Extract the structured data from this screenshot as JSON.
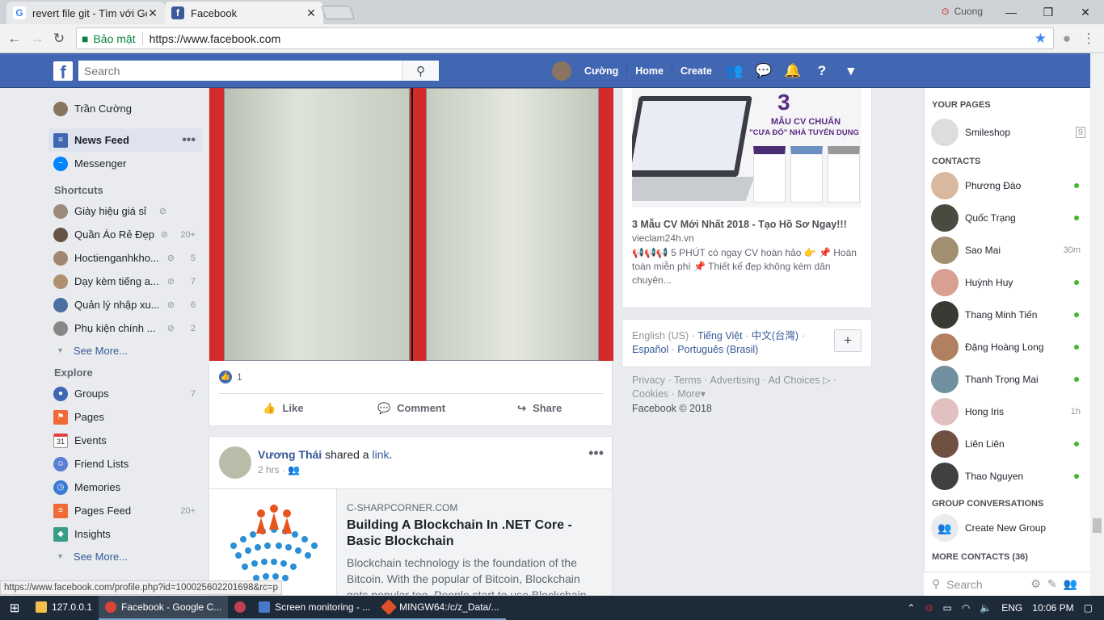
{
  "browser": {
    "tabs": [
      {
        "title": "revert file git - Tìm với Go",
        "favicon": "G"
      },
      {
        "title": "Facebook",
        "favicon": "f"
      }
    ],
    "user": "Cuong",
    "secure_label": "Bảo mật",
    "url": "https://www.facebook.com",
    "status_url": "https://www.facebook.com/profile.php?id=100025602201698&rc=p"
  },
  "fbbar": {
    "search_placeholder": "Search",
    "profile_name": "Cường",
    "home": "Home",
    "create": "Create"
  },
  "left": {
    "profile": "Trần Cường",
    "main": [
      {
        "label": "News Feed",
        "icon": "news-feed-icon"
      },
      {
        "label": "Messenger",
        "icon": "messenger-icon"
      }
    ],
    "shortcuts_title": "Shortcuts",
    "shortcuts": [
      {
        "label": "Giày hiệu giá sỉ",
        "badge": ""
      },
      {
        "label": "Quần Áo Rẻ Đẹp",
        "badge": "20+"
      },
      {
        "label": "Hoctienganhkho...",
        "badge": "5"
      },
      {
        "label": "Dạy kèm tiếng a...",
        "badge": "7"
      },
      {
        "label": "Quản lý nhập xu...",
        "badge": "6"
      },
      {
        "label": "Phụ kiện chính ...",
        "badge": "2"
      }
    ],
    "see_more": "See More...",
    "explore_title": "Explore",
    "explore": [
      {
        "label": "Groups",
        "badge": "7",
        "icon": "groups-icon"
      },
      {
        "label": "Pages",
        "badge": "",
        "icon": "pages-flag-icon"
      },
      {
        "label": "Events",
        "badge": "",
        "icon": "calendar-icon"
      },
      {
        "label": "Friend Lists",
        "badge": "",
        "icon": "friend-lists-icon"
      },
      {
        "label": "Memories",
        "badge": "",
        "icon": "clock-icon"
      },
      {
        "label": "Pages Feed",
        "badge": "20+",
        "icon": "pages-feed-icon"
      },
      {
        "label": "Insights",
        "badge": "",
        "icon": "cube-icon"
      }
    ],
    "see_more_2": "See More..."
  },
  "post1": {
    "like_count": "1",
    "like": "Like",
    "comment": "Comment",
    "share": "Share"
  },
  "post2": {
    "author": "Vương Thái",
    "verb": " shared a ",
    "object": "link",
    "time": "2 hrs · ",
    "link_domain": "C-SHARPCORNER.COM",
    "link_title": "Building A Blockchain In .NET Core - Basic Blockchain",
    "link_desc": "Blockchain technology is the foundation of the Bitcoin. With the popular of Bitcoin, Blockchain gets popular too. People start to use Blockchain..."
  },
  "ad": {
    "image_number": "3",
    "image_line1": "MẪU CV CHUẨN",
    "image_line2": "\"CƯA ĐỔ\" NHÀ TUYỂN DỤNG",
    "title": "3 Mẫu CV Mới Nhất 2018 - Tạo Hồ Sơ Ngay!!!",
    "domain": "vieclam24h.vn",
    "text": "📢📢📢 5 PHÚT có ngay CV hoàn hảo 👉 📌 Hoàn toàn miễn phí 📌 Thiết kế đẹp không kém dân chuyên..."
  },
  "lang": {
    "current": "English (US)",
    "options": [
      "Tiếng Việt",
      "中文(台灣)",
      "Español",
      "Português (Brasil)"
    ]
  },
  "footer": {
    "links": [
      "Privacy",
      "Terms",
      "Advertising",
      "Ad Choices",
      "Cookies",
      "More"
    ],
    "copyright": "Facebook © 2018"
  },
  "right": {
    "your_pages": "YOUR PAGES",
    "page": {
      "name": "Smileshop",
      "badge": "9"
    },
    "contacts_title": "CONTACTS",
    "contacts": [
      {
        "name": "Phương Đào",
        "status": "online",
        "color": "#d9b8a0"
      },
      {
        "name": "Quốc Trạng",
        "status": "online",
        "color": "#4a4a40"
      },
      {
        "name": "Sao Mai",
        "status": "30m",
        "color": "#a09070"
      },
      {
        "name": "Huỳnh Huy",
        "status": "online",
        "color": "#d8a090"
      },
      {
        "name": "Thang Minh Tiến",
        "status": "online",
        "color": "#3a3a35"
      },
      {
        "name": "Đặng Hoàng Long",
        "status": "online",
        "color": "#b08060"
      },
      {
        "name": "Thanh Trọng Mai",
        "status": "online",
        "color": "#7090a0"
      },
      {
        "name": "Hong Iris",
        "status": "1h",
        "color": "#e0c0c0"
      },
      {
        "name": "Liên Liên",
        "status": "online",
        "color": "#705040"
      },
      {
        "name": "Thao Nguyen",
        "status": "online",
        "color": "#404040"
      }
    ],
    "group_title": "GROUP CONVERSATIONS",
    "create_group": "Create New Group",
    "more_contacts": "MORE CONTACTS (36)",
    "search_placeholder": "Search"
  },
  "taskbar": {
    "items": [
      {
        "label": "127.0.0.1",
        "color": "#f3c14b"
      },
      {
        "label": "Facebook - Google C...",
        "color": "#db4437"
      },
      {
        "label": "",
        "color": "#c04050"
      },
      {
        "label": "Screen monitoring - ...",
        "color": "#4a78c8"
      },
      {
        "label": "MINGW64:/c/z_Data/...",
        "color": "#e0502a"
      }
    ],
    "lang": "ENG",
    "time": "10:06 PM"
  }
}
